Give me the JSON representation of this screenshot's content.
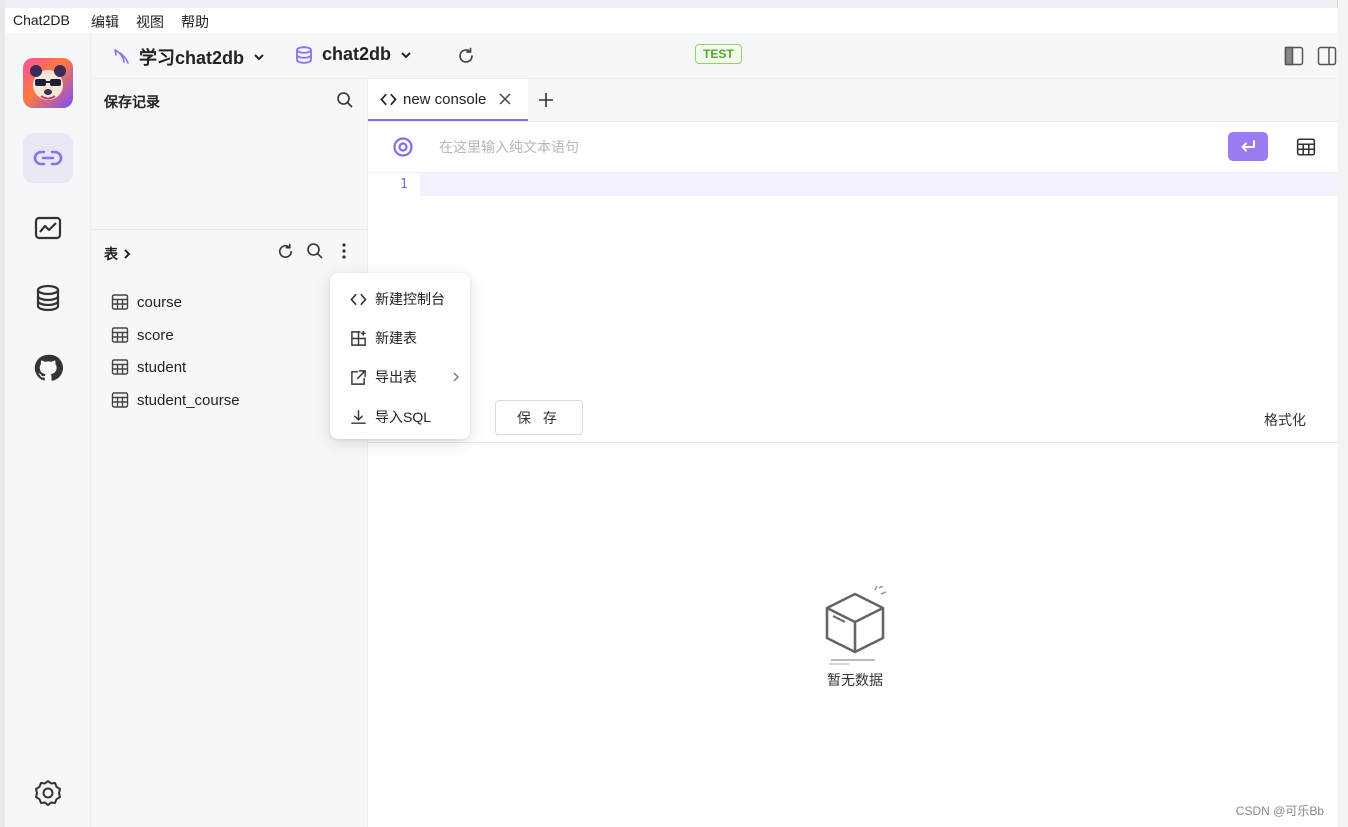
{
  "app": {
    "title": "Chat2DB"
  },
  "menubar": {
    "items": [
      "Chat2DB",
      "编辑",
      "视图",
      "帮助"
    ]
  },
  "topbar": {
    "connection_name": "学习chat2db",
    "database_name": "chat2db",
    "env_badge": "TEST"
  },
  "saved_panel": {
    "title": "保存记录"
  },
  "tables_panel": {
    "title": "表",
    "tables": [
      "course",
      "score",
      "student",
      "student_course"
    ]
  },
  "context_menu": {
    "items": [
      {
        "label": "新建控制台",
        "icon": "code-icon"
      },
      {
        "label": "新建表",
        "icon": "table-add-icon"
      },
      {
        "label": "导出表",
        "icon": "export-icon",
        "has_submenu": true
      },
      {
        "label": "导入SQL",
        "icon": "download-icon"
      }
    ]
  },
  "tabs": [
    {
      "label": "new console",
      "active": true
    }
  ],
  "editor": {
    "ai_placeholder": "在这里输入纯文本语句",
    "line_numbers": [
      "1"
    ],
    "save_label": "保 存",
    "format_label": "格式化"
  },
  "results": {
    "empty_text": "暂无数据"
  },
  "watermark": "CSDN @可乐Bb",
  "colors": {
    "accent": "#7a6ff0",
    "send_button": "#9a7cf2",
    "test_badge": "#52a92a"
  }
}
